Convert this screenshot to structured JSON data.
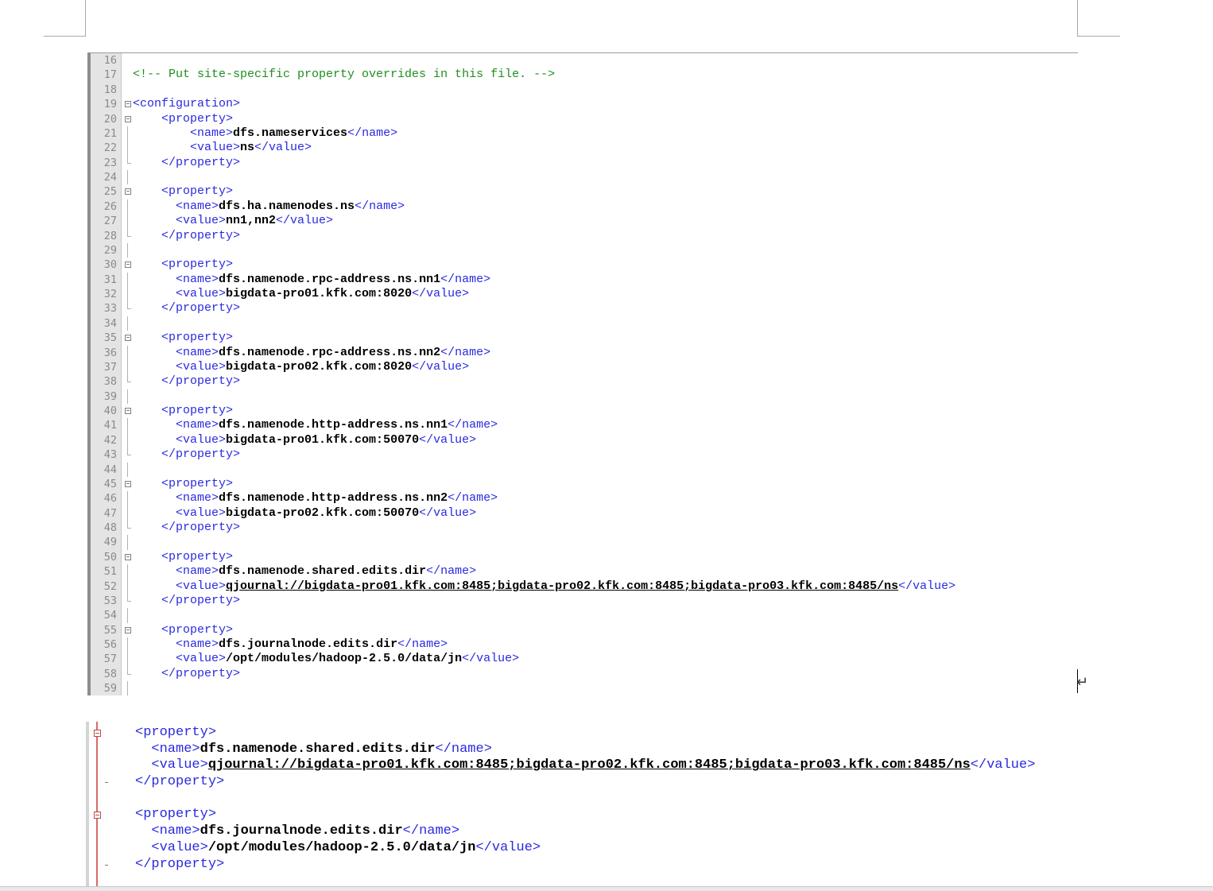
{
  "editor_top": {
    "lines": [
      {
        "n": "16",
        "fold": "",
        "indent": "",
        "parts": []
      },
      {
        "n": "17",
        "fold": "",
        "indent": "",
        "parts": [
          {
            "t": "<!-- Put site-specific property overrides in this file. -->",
            "c": "cmt"
          }
        ]
      },
      {
        "n": "18",
        "fold": "",
        "indent": "",
        "parts": []
      },
      {
        "n": "19",
        "fold": "box",
        "indent": "",
        "parts": [
          {
            "t": "<configuration>",
            "c": "tag"
          }
        ]
      },
      {
        "n": "20",
        "fold": "box",
        "indent": "    ",
        "parts": [
          {
            "t": "<property>",
            "c": "tag"
          }
        ]
      },
      {
        "n": "21",
        "fold": "vline",
        "indent": "        ",
        "parts": [
          {
            "t": "<name>",
            "c": "tag"
          },
          {
            "t": "dfs.nameservices",
            "c": "txt"
          },
          {
            "t": "</name>",
            "c": "tag"
          }
        ]
      },
      {
        "n": "22",
        "fold": "vline",
        "indent": "        ",
        "parts": [
          {
            "t": "<value>",
            "c": "tag"
          },
          {
            "t": "ns",
            "c": "txt"
          },
          {
            "t": "</value>",
            "c": "tag"
          }
        ]
      },
      {
        "n": "23",
        "fold": "tick",
        "indent": "    ",
        "parts": [
          {
            "t": "</property>",
            "c": "tag"
          }
        ]
      },
      {
        "n": "24",
        "fold": "vline",
        "indent": "",
        "parts": []
      },
      {
        "n": "25",
        "fold": "box",
        "indent": "    ",
        "parts": [
          {
            "t": "<property>",
            "c": "tag"
          }
        ]
      },
      {
        "n": "26",
        "fold": "vline",
        "indent": "      ",
        "parts": [
          {
            "t": "<name>",
            "c": "tag"
          },
          {
            "t": "dfs.ha.namenodes.ns",
            "c": "txt"
          },
          {
            "t": "</name>",
            "c": "tag"
          }
        ]
      },
      {
        "n": "27",
        "fold": "vline",
        "indent": "      ",
        "parts": [
          {
            "t": "<value>",
            "c": "tag"
          },
          {
            "t": "nn1,nn2",
            "c": "txt"
          },
          {
            "t": "</value>",
            "c": "tag"
          }
        ]
      },
      {
        "n": "28",
        "fold": "tick",
        "indent": "    ",
        "parts": [
          {
            "t": "</property>",
            "c": "tag"
          }
        ]
      },
      {
        "n": "29",
        "fold": "vline",
        "indent": "",
        "parts": []
      },
      {
        "n": "30",
        "fold": "box",
        "indent": "    ",
        "parts": [
          {
            "t": "<property>",
            "c": "tag"
          }
        ]
      },
      {
        "n": "31",
        "fold": "vline",
        "indent": "      ",
        "parts": [
          {
            "t": "<name>",
            "c": "tag"
          },
          {
            "t": "dfs.namenode.rpc-address.ns.nn1",
            "c": "txt"
          },
          {
            "t": "</name>",
            "c": "tag"
          }
        ]
      },
      {
        "n": "32",
        "fold": "vline",
        "indent": "      ",
        "parts": [
          {
            "t": "<value>",
            "c": "tag"
          },
          {
            "t": "bigdata-pro01.kfk.com:8020",
            "c": "txt"
          },
          {
            "t": "</value>",
            "c": "tag"
          }
        ]
      },
      {
        "n": "33",
        "fold": "tick",
        "indent": "    ",
        "parts": [
          {
            "t": "</property>",
            "c": "tag"
          }
        ]
      },
      {
        "n": "34",
        "fold": "vline",
        "indent": "",
        "parts": []
      },
      {
        "n": "35",
        "fold": "box",
        "indent": "    ",
        "parts": [
          {
            "t": "<property>",
            "c": "tag"
          }
        ]
      },
      {
        "n": "36",
        "fold": "vline",
        "indent": "      ",
        "parts": [
          {
            "t": "<name>",
            "c": "tag"
          },
          {
            "t": "dfs.namenode.rpc-address.ns.nn2",
            "c": "txt"
          },
          {
            "t": "</name>",
            "c": "tag"
          }
        ]
      },
      {
        "n": "37",
        "fold": "vline",
        "indent": "      ",
        "parts": [
          {
            "t": "<value>",
            "c": "tag"
          },
          {
            "t": "bigdata-pro02.kfk.com:8020",
            "c": "txt"
          },
          {
            "t": "</value>",
            "c": "tag"
          }
        ]
      },
      {
        "n": "38",
        "fold": "tick",
        "indent": "    ",
        "parts": [
          {
            "t": "</property>",
            "c": "tag"
          }
        ]
      },
      {
        "n": "39",
        "fold": "vline",
        "indent": "",
        "parts": []
      },
      {
        "n": "40",
        "fold": "box",
        "indent": "    ",
        "parts": [
          {
            "t": "<property>",
            "c": "tag"
          }
        ]
      },
      {
        "n": "41",
        "fold": "vline",
        "indent": "      ",
        "parts": [
          {
            "t": "<name>",
            "c": "tag"
          },
          {
            "t": "dfs.namenode.http-address.ns.nn1",
            "c": "txt"
          },
          {
            "t": "</name>",
            "c": "tag"
          }
        ]
      },
      {
        "n": "42",
        "fold": "vline",
        "indent": "      ",
        "parts": [
          {
            "t": "<value>",
            "c": "tag"
          },
          {
            "t": "bigdata-pro01.kfk.com:50070",
            "c": "txt"
          },
          {
            "t": "</value>",
            "c": "tag"
          }
        ]
      },
      {
        "n": "43",
        "fold": "tick",
        "indent": "    ",
        "parts": [
          {
            "t": "</property>",
            "c": "tag"
          }
        ]
      },
      {
        "n": "44",
        "fold": "vline",
        "indent": "",
        "parts": []
      },
      {
        "n": "45",
        "fold": "box",
        "indent": "    ",
        "parts": [
          {
            "t": "<property>",
            "c": "tag"
          }
        ]
      },
      {
        "n": "46",
        "fold": "vline",
        "indent": "      ",
        "parts": [
          {
            "t": "<name>",
            "c": "tag"
          },
          {
            "t": "dfs.namenode.http-address.ns.nn2",
            "c": "txt"
          },
          {
            "t": "</name>",
            "c": "tag"
          }
        ]
      },
      {
        "n": "47",
        "fold": "vline",
        "indent": "      ",
        "parts": [
          {
            "t": "<value>",
            "c": "tag"
          },
          {
            "t": "bigdata-pro02.kfk.com:50070",
            "c": "txt"
          },
          {
            "t": "</value>",
            "c": "tag"
          }
        ]
      },
      {
        "n": "48",
        "fold": "tick",
        "indent": "    ",
        "parts": [
          {
            "t": "</property>",
            "c": "tag"
          }
        ]
      },
      {
        "n": "49",
        "fold": "vline",
        "indent": "",
        "parts": []
      },
      {
        "n": "50",
        "fold": "box",
        "indent": "    ",
        "parts": [
          {
            "t": "<property>",
            "c": "tag"
          }
        ]
      },
      {
        "n": "51",
        "fold": "vline",
        "indent": "      ",
        "parts": [
          {
            "t": "<name>",
            "c": "tag"
          },
          {
            "t": "dfs.namenode.shared.edits.dir",
            "c": "txt"
          },
          {
            "t": "</name>",
            "c": "tag"
          }
        ]
      },
      {
        "n": "52",
        "fold": "vline",
        "indent": "      ",
        "parts": [
          {
            "t": "<value>",
            "c": "tag"
          },
          {
            "t": "qjournal://bigdata-pro01.kfk.com:8485;bigdata-pro02.kfk.com:8485;bigdata-pro03.kfk.com:8485/ns",
            "c": "txt ul"
          },
          {
            "t": "</value>",
            "c": "tag"
          }
        ]
      },
      {
        "n": "53",
        "fold": "tick",
        "indent": "    ",
        "parts": [
          {
            "t": "</property>",
            "c": "tag"
          }
        ]
      },
      {
        "n": "54",
        "fold": "vline",
        "indent": "",
        "parts": []
      },
      {
        "n": "55",
        "fold": "box",
        "indent": "    ",
        "parts": [
          {
            "t": "<property>",
            "c": "tag"
          }
        ]
      },
      {
        "n": "56",
        "fold": "vline",
        "indent": "      ",
        "parts": [
          {
            "t": "<name>",
            "c": "tag"
          },
          {
            "t": "dfs.journalnode.edits.dir",
            "c": "txt"
          },
          {
            "t": "</name>",
            "c": "tag"
          }
        ]
      },
      {
        "n": "57",
        "fold": "vline",
        "indent": "      ",
        "parts": [
          {
            "t": "<value>",
            "c": "tag"
          },
          {
            "t": "/opt/modules/hadoop-2.5.0/data/jn",
            "c": "txt"
          },
          {
            "t": "</value>",
            "c": "tag"
          }
        ]
      },
      {
        "n": "58",
        "fold": "tick",
        "indent": "    ",
        "parts": [
          {
            "t": "</property>",
            "c": "tag"
          }
        ]
      },
      {
        "n": "59",
        "fold": "vline",
        "indent": "",
        "parts": []
      }
    ]
  },
  "editor_bottom": {
    "lines": [
      {
        "fold": "box",
        "indent": "",
        "parts": [
          {
            "t": "<property>",
            "c": "tag"
          }
        ]
      },
      {
        "fold": "",
        "indent": "  ",
        "parts": [
          {
            "t": "<name>",
            "c": "tag"
          },
          {
            "t": "dfs.namenode.shared.edits.dir",
            "c": "txt"
          },
          {
            "t": "</name>",
            "c": "tag"
          }
        ]
      },
      {
        "fold": "",
        "indent": "  ",
        "parts": [
          {
            "t": "<value>",
            "c": "tag"
          },
          {
            "t": "qjournal://bigdata-pro01.kfk.com:8485;bigdata-pro02.kfk.com:8485;bigdata-pro03.kfk.com:8485/ns",
            "c": "txt ul"
          },
          {
            "t": "</value>",
            "c": "tag"
          }
        ]
      },
      {
        "fold": "tick",
        "indent": "",
        "parts": [
          {
            "t": "</property>",
            "c": "tag"
          }
        ]
      },
      {
        "fold": "",
        "indent": "",
        "parts": []
      },
      {
        "fold": "box",
        "indent": "",
        "parts": [
          {
            "t": "<property>",
            "c": "tag"
          }
        ]
      },
      {
        "fold": "",
        "indent": "  ",
        "parts": [
          {
            "t": "<name>",
            "c": "tag"
          },
          {
            "t": "dfs.journalnode.edits.dir",
            "c": "txt"
          },
          {
            "t": "</name>",
            "c": "tag"
          }
        ]
      },
      {
        "fold": "",
        "indent": "  ",
        "parts": [
          {
            "t": "<value>",
            "c": "tag"
          },
          {
            "t": "/opt/modules/hadoop-2.5.0/data/jn",
            "c": "txt"
          },
          {
            "t": "</value>",
            "c": "tag"
          }
        ]
      },
      {
        "fold": "tick",
        "indent": "",
        "parts": [
          {
            "t": "</property>",
            "c": "tag"
          }
        ]
      }
    ]
  },
  "return_mark": "↵"
}
